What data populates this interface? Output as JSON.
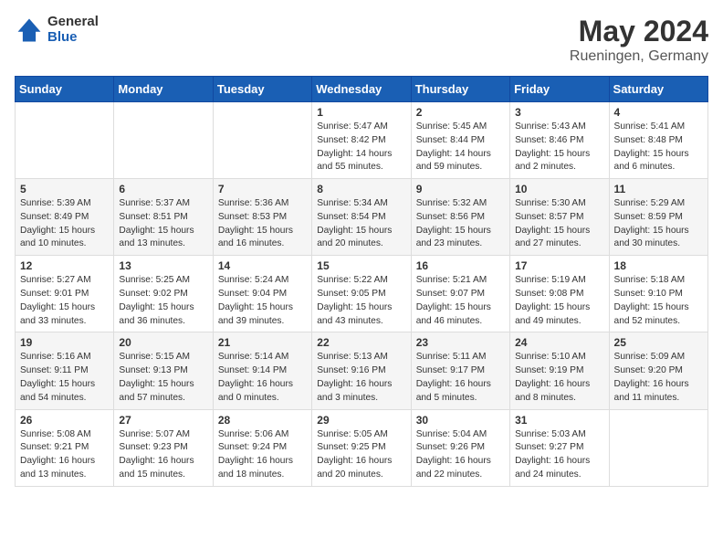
{
  "logo": {
    "general": "General",
    "blue": "Blue"
  },
  "title": {
    "month": "May 2024",
    "location": "Rueningen, Germany"
  },
  "headers": [
    "Sunday",
    "Monday",
    "Tuesday",
    "Wednesday",
    "Thursday",
    "Friday",
    "Saturday"
  ],
  "weeks": [
    [
      {
        "day": "",
        "info": ""
      },
      {
        "day": "",
        "info": ""
      },
      {
        "day": "",
        "info": ""
      },
      {
        "day": "1",
        "info": "Sunrise: 5:47 AM\nSunset: 8:42 PM\nDaylight: 14 hours\nand 55 minutes."
      },
      {
        "day": "2",
        "info": "Sunrise: 5:45 AM\nSunset: 8:44 PM\nDaylight: 14 hours\nand 59 minutes."
      },
      {
        "day": "3",
        "info": "Sunrise: 5:43 AM\nSunset: 8:46 PM\nDaylight: 15 hours\nand 2 minutes."
      },
      {
        "day": "4",
        "info": "Sunrise: 5:41 AM\nSunset: 8:48 PM\nDaylight: 15 hours\nand 6 minutes."
      }
    ],
    [
      {
        "day": "5",
        "info": "Sunrise: 5:39 AM\nSunset: 8:49 PM\nDaylight: 15 hours\nand 10 minutes."
      },
      {
        "day": "6",
        "info": "Sunrise: 5:37 AM\nSunset: 8:51 PM\nDaylight: 15 hours\nand 13 minutes."
      },
      {
        "day": "7",
        "info": "Sunrise: 5:36 AM\nSunset: 8:53 PM\nDaylight: 15 hours\nand 16 minutes."
      },
      {
        "day": "8",
        "info": "Sunrise: 5:34 AM\nSunset: 8:54 PM\nDaylight: 15 hours\nand 20 minutes."
      },
      {
        "day": "9",
        "info": "Sunrise: 5:32 AM\nSunset: 8:56 PM\nDaylight: 15 hours\nand 23 minutes."
      },
      {
        "day": "10",
        "info": "Sunrise: 5:30 AM\nSunset: 8:57 PM\nDaylight: 15 hours\nand 27 minutes."
      },
      {
        "day": "11",
        "info": "Sunrise: 5:29 AM\nSunset: 8:59 PM\nDaylight: 15 hours\nand 30 minutes."
      }
    ],
    [
      {
        "day": "12",
        "info": "Sunrise: 5:27 AM\nSunset: 9:01 PM\nDaylight: 15 hours\nand 33 minutes."
      },
      {
        "day": "13",
        "info": "Sunrise: 5:25 AM\nSunset: 9:02 PM\nDaylight: 15 hours\nand 36 minutes."
      },
      {
        "day": "14",
        "info": "Sunrise: 5:24 AM\nSunset: 9:04 PM\nDaylight: 15 hours\nand 39 minutes."
      },
      {
        "day": "15",
        "info": "Sunrise: 5:22 AM\nSunset: 9:05 PM\nDaylight: 15 hours\nand 43 minutes."
      },
      {
        "day": "16",
        "info": "Sunrise: 5:21 AM\nSunset: 9:07 PM\nDaylight: 15 hours\nand 46 minutes."
      },
      {
        "day": "17",
        "info": "Sunrise: 5:19 AM\nSunset: 9:08 PM\nDaylight: 15 hours\nand 49 minutes."
      },
      {
        "day": "18",
        "info": "Sunrise: 5:18 AM\nSunset: 9:10 PM\nDaylight: 15 hours\nand 52 minutes."
      }
    ],
    [
      {
        "day": "19",
        "info": "Sunrise: 5:16 AM\nSunset: 9:11 PM\nDaylight: 15 hours\nand 54 minutes."
      },
      {
        "day": "20",
        "info": "Sunrise: 5:15 AM\nSunset: 9:13 PM\nDaylight: 15 hours\nand 57 minutes."
      },
      {
        "day": "21",
        "info": "Sunrise: 5:14 AM\nSunset: 9:14 PM\nDaylight: 16 hours\nand 0 minutes."
      },
      {
        "day": "22",
        "info": "Sunrise: 5:13 AM\nSunset: 9:16 PM\nDaylight: 16 hours\nand 3 minutes."
      },
      {
        "day": "23",
        "info": "Sunrise: 5:11 AM\nSunset: 9:17 PM\nDaylight: 16 hours\nand 5 minutes."
      },
      {
        "day": "24",
        "info": "Sunrise: 5:10 AM\nSunset: 9:19 PM\nDaylight: 16 hours\nand 8 minutes."
      },
      {
        "day": "25",
        "info": "Sunrise: 5:09 AM\nSunset: 9:20 PM\nDaylight: 16 hours\nand 11 minutes."
      }
    ],
    [
      {
        "day": "26",
        "info": "Sunrise: 5:08 AM\nSunset: 9:21 PM\nDaylight: 16 hours\nand 13 minutes."
      },
      {
        "day": "27",
        "info": "Sunrise: 5:07 AM\nSunset: 9:23 PM\nDaylight: 16 hours\nand 15 minutes."
      },
      {
        "day": "28",
        "info": "Sunrise: 5:06 AM\nSunset: 9:24 PM\nDaylight: 16 hours\nand 18 minutes."
      },
      {
        "day": "29",
        "info": "Sunrise: 5:05 AM\nSunset: 9:25 PM\nDaylight: 16 hours\nand 20 minutes."
      },
      {
        "day": "30",
        "info": "Sunrise: 5:04 AM\nSunset: 9:26 PM\nDaylight: 16 hours\nand 22 minutes."
      },
      {
        "day": "31",
        "info": "Sunrise: 5:03 AM\nSunset: 9:27 PM\nDaylight: 16 hours\nand 24 minutes."
      },
      {
        "day": "",
        "info": ""
      }
    ]
  ]
}
